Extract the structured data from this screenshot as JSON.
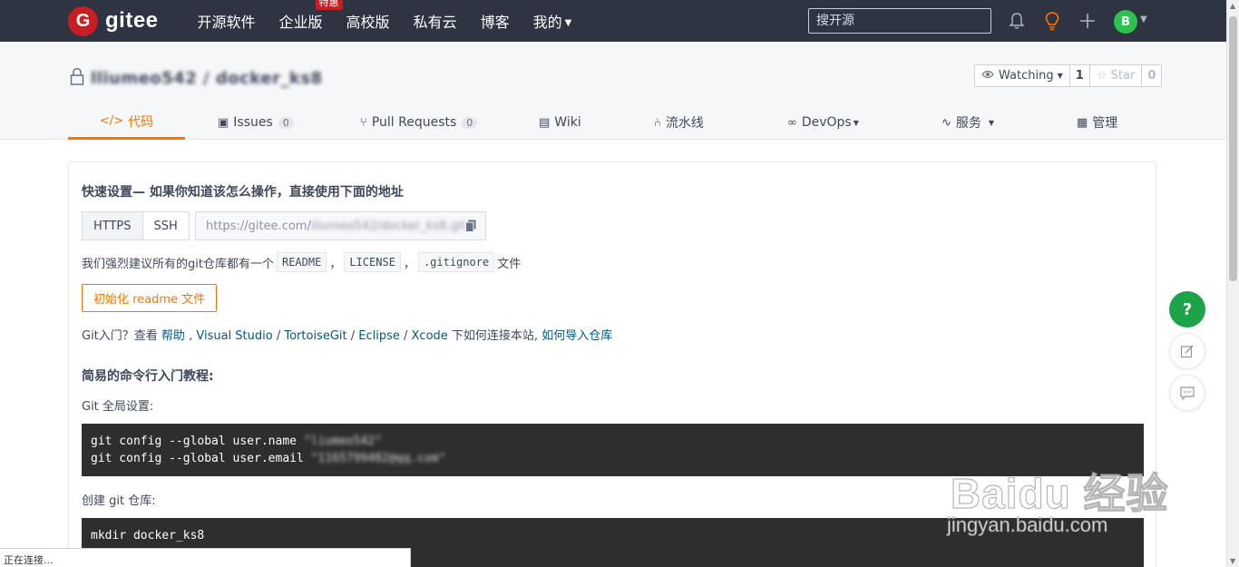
{
  "nav": {
    "logo_letter": "G",
    "logo_text": "gitee",
    "links": [
      {
        "label": "开源软件"
      },
      {
        "label": "企业版",
        "badge": "特惠"
      },
      {
        "label": "高校版"
      },
      {
        "label": "私有云"
      },
      {
        "label": "博客"
      },
      {
        "label": "我的",
        "dropdown": true
      }
    ],
    "search_placeholder": "搜开源",
    "icons": [
      "bell-icon",
      "lightbulb-icon",
      "plus-icon"
    ],
    "avatar_letter": "B",
    "colors": {
      "bg": "#2e3442",
      "brand": "#c71d23",
      "avatar": "#2bc24e",
      "accent": "#fe7300"
    }
  },
  "repo": {
    "owner": "lliumeo542",
    "separator": "/",
    "name": "docker_ks8",
    "watch_label": "Watching",
    "watch_count": "1",
    "star_label": "Star",
    "star_count": "0"
  },
  "tabs": [
    {
      "label": "代码",
      "icon": "code-icon",
      "active": true
    },
    {
      "label": "Issues",
      "icon": "issues-icon",
      "count": "0"
    },
    {
      "label": "Pull Requests",
      "icon": "pull-request-icon",
      "count": "0"
    },
    {
      "label": "Wiki",
      "icon": "wiki-icon"
    },
    {
      "label": "流水线",
      "icon": "pipeline-icon"
    },
    {
      "label": "DevOps",
      "icon": "devops-icon",
      "dropdown": true
    },
    {
      "label": "服务",
      "icon": "service-icon",
      "dropdown": true
    },
    {
      "label": "管理",
      "icon": "manage-icon"
    }
  ],
  "quick": {
    "heading": "快速设置— 如果你知道该怎么操作，直接使用下面的地址",
    "protocols": [
      "HTTPS",
      "SSH"
    ],
    "url_prefix": "https://gitee.com/",
    "url_rest": "lliumeo542/docker_ks8.git",
    "recommend_prefix": "我们强烈建议所有的git仓库都有一个",
    "files": [
      "README",
      "LICENSE",
      ".gitignore"
    ],
    "recommend_sep": "，",
    "recommend_suffix": "文件",
    "init_button": "初始化 readme 文件",
    "help_prefix": "Git入门？查看 ",
    "help_link": "帮助",
    "help_sep1": " , ",
    "tools": [
      "Visual Studio",
      "TortoiseGit",
      "Eclipse",
      "Xcode"
    ],
    "tool_sep": " / ",
    "help_mid": " 下如何连接本站, ",
    "import_link": "如何导入仓库"
  },
  "tutorial": {
    "heading": "简易的命令行入门教程:",
    "global_label": "Git 全局设置:",
    "global_cmd1": "git config --global user.name ",
    "global_val1": "\"liumeo542\"",
    "global_cmd2": "git config --global user.email ",
    "global_val2": "\"1165799482@qq.com\"",
    "create_label": "创建 git 仓库:",
    "create_cmd": "mkdir docker_ks8"
  },
  "float_buttons": [
    "help-icon",
    "edit-icon",
    "chat-icon"
  ],
  "float_help_glyph": "?",
  "status": "正在连接...",
  "watermark": {
    "main": "Baidu 经验",
    "sub": "jingyan.baidu.com"
  }
}
